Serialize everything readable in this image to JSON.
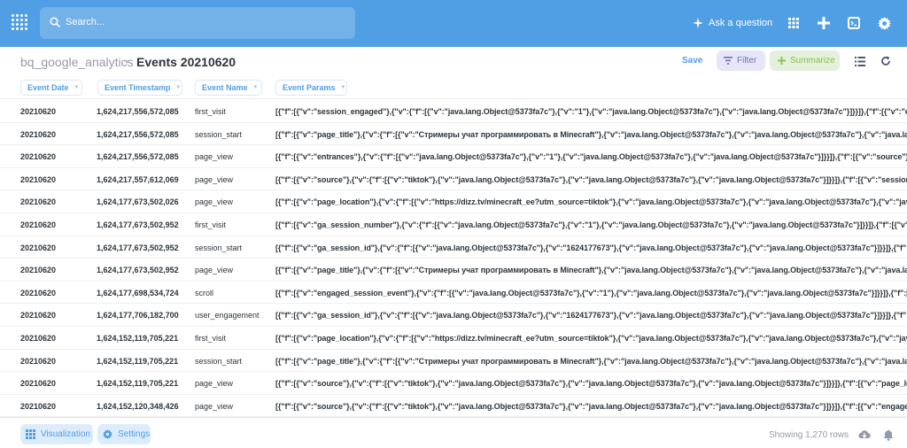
{
  "topnav": {
    "search_placeholder": "Search...",
    "ask_label": "Ask a question",
    "icons": [
      "metabase-logo-icon",
      "search-icon",
      "sparkle-icon",
      "grid-icon",
      "plus-icon",
      "terminal-icon",
      "gear-icon"
    ]
  },
  "header": {
    "database": "bq_google_analytics",
    "separator": "•",
    "table": "Events 20210620",
    "save_label": "Save",
    "filter_label": "Filter",
    "summarize_label": "Summarize"
  },
  "columns": [
    "Event Date",
    "Event Timestamp",
    "Event Name",
    "Event Params"
  ],
  "rows": [
    [
      "20210620",
      "1,624,217,556,572,085",
      "first_visit",
      "[{\"f\":[{\"v\":\"session_engaged\"},{\"v\":{\"f\":[{\"v\":\"java.lang.Object@5373fa7c\"},{\"v\":\"1\"},{\"v\":\"java.lang.Object@5373fa7c\"},{\"v\":\"java.lang.Object@5373fa7c\"}]}}]},{\"f\":[{\"v\":\"engaged"
    ],
    [
      "20210620",
      "1,624,217,556,572,085",
      "session_start",
      "[{\"f\":[{\"v\":\"page_title\"},{\"v\":{\"f\":[{\"v\":\"Стримеры учат программировать в Minecraft\"},{\"v\":\"java.lang.Object@5373fa7c\"},{\"v\":\"java.lang.Object@5373fa7c\"},{\"v\":\"java.la"
    ],
    [
      "20210620",
      "1,624,217,556,572,085",
      "page_view",
      "[{\"f\":[{\"v\":\"entrances\"},{\"v\":{\"f\":[{\"v\":\"java.lang.Object@5373fa7c\"},{\"v\":\"1\"},{\"v\":\"java.lang.Object@5373fa7c\"},{\"v\":\"java.lang.Object@5373fa7c\"}]}}]},{\"f\":[{\"v\":\"source\"},{\"v"
    ],
    [
      "20210620",
      "1,624,217,557,612,069",
      "page_view",
      "[{\"f\":[{\"v\":\"source\"},{\"v\":{\"f\":[{\"v\":\"tiktok\"},{\"v\":\"java.lang.Object@5373fa7c\"},{\"v\":\"java.lang.Object@5373fa7c\"},{\"v\":\"java.lang.Object@5373fa7c\"}]}}]},{\"f\":[{\"v\":\"session_enga"
    ],
    [
      "20210620",
      "1,624,177,673,502,026",
      "page_view",
      "[{\"f\":[{\"v\":\"page_location\"},{\"v\":{\"f\":[{\"v\":\"https://dizz.tv/minecraft_ee?utm_source=tiktok\"},{\"v\":\"java.lang.Object@5373fa7c\"},{\"v\":\"java.lang.Object@5373fa7c\"},{\"v\":\"java.la"
    ],
    [
      "20210620",
      "1,624,177,673,502,952",
      "first_visit",
      "[{\"f\":[{\"v\":\"ga_session_number\"},{\"v\":{\"f\":[{\"v\":\"java.lang.Object@5373fa7c\"},{\"v\":\"1\"},{\"v\":\"java.lang.Object@5373fa7c\"},{\"v\":\"java.lang.Object@5373fa7c\"}]}}]},{\"f\":[{\"v\":\"page_"
    ],
    [
      "20210620",
      "1,624,177,673,502,952",
      "session_start",
      "[{\"f\":[{\"v\":\"ga_session_id\"},{\"v\":{\"f\":[{\"v\":\"java.lang.Object@5373fa7c\"},{\"v\":\"1624177673\"},{\"v\":\"java.lang.Object@5373fa7c\"},{\"v\":\"java.lang.Object@5373fa7c\"}]}}]},{\"f\":[{\"v"
    ],
    [
      "20210620",
      "1,624,177,673,502,952",
      "page_view",
      "[{\"f\":[{\"v\":\"page_title\"},{\"v\":{\"f\":[{\"v\":\"Стримеры учат программировать в Minecraft\"},{\"v\":\"java.lang.Object@5373fa7c\"},{\"v\":\"java.lang.Object@5373fa7c\"},{\"v\":\"java.la"
    ],
    [
      "20210620",
      "1,624,177,698,534,724",
      "scroll",
      "[{\"f\":[{\"v\":\"engaged_session_event\"},{\"v\":{\"f\":[{\"v\":\"java.lang.Object@5373fa7c\"},{\"v\":\"1\"},{\"v\":\"java.lang.Object@5373fa7c\"},{\"v\":\"java.lang.Object@5373fa7c\"}]}}]},{\"f\":[{\"v"
    ],
    [
      "20210620",
      "1,624,177,706,182,700",
      "user_engagement",
      "[{\"f\":[{\"v\":\"ga_session_id\"},{\"v\":{\"f\":[{\"v\":\"java.lang.Object@5373fa7c\"},{\"v\":\"1624177673\"},{\"v\":\"java.lang.Object@5373fa7c\"},{\"v\":\"java.lang.Object@5373fa7c\"}]}}]},{\"f\":[{\"v"
    ],
    [
      "20210620",
      "1,624,152,119,705,221",
      "first_visit",
      "[{\"f\":[{\"v\":\"page_location\"},{\"v\":{\"f\":[{\"v\":\"https://dizz.tv/minecraft_ee?utm_source=tiktok\"},{\"v\":\"java.lang.Object@5373fa7c\"},{\"v\":\"java.lang.Object@5373fa7c\"},{\"v\":\"java.la"
    ],
    [
      "20210620",
      "1,624,152,119,705,221",
      "session_start",
      "[{\"f\":[{\"v\":\"page_title\"},{\"v\":{\"f\":[{\"v\":\"Стримеры учат программировать в Minecraft\"},{\"v\":\"java.lang.Object@5373fa7c\"},{\"v\":\"java.lang.Object@5373fa7c\"},{\"v\":\"java.la"
    ],
    [
      "20210620",
      "1,624,152,119,705,221",
      "page_view",
      "[{\"f\":[{\"v\":\"source\"},{\"v\":{\"f\":[{\"v\":\"tiktok\"},{\"v\":\"java.lang.Object@5373fa7c\"},{\"v\":\"java.lang.Object@5373fa7c\"},{\"v\":\"java.lang.Object@5373fa7c\"}]}}]},{\"f\":[{\"v\":\"page_location"
    ],
    [
      "20210620",
      "1,624,152,120,348,426",
      "page_view",
      "[{\"f\":[{\"v\":\"source\"},{\"v\":{\"f\":[{\"v\":\"tiktok\"},{\"v\":\"java.lang.Object@5373fa7c\"},{\"v\":\"java.lang.Object@5373fa7c\"},{\"v\":\"java.lang.Object@5373fa7c\"}]}}]},{\"f\":[{\"v\":\"engaged_sessi"
    ]
  ],
  "footer": {
    "visualization_label": "Visualization",
    "settings_label": "Settings",
    "row_count": "Showing 1,270 rows"
  },
  "colors": {
    "brand": "#509ee3",
    "filter": "#7172ad",
    "summarize": "#88bf4d"
  }
}
